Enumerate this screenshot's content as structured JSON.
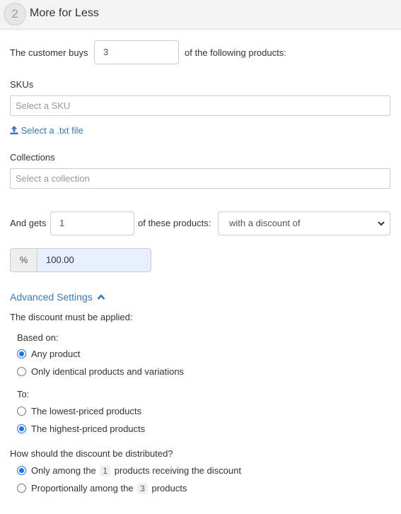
{
  "header": {
    "step": "2",
    "title": "More for Less"
  },
  "buy": {
    "prefix": "The customer buys",
    "quantity": "3",
    "suffix": "of the following products:"
  },
  "skus": {
    "label": "SKUs",
    "placeholder": "Select a SKU",
    "upload_link": "Select a .txt file"
  },
  "collections": {
    "label": "Collections",
    "placeholder": "Select a collection"
  },
  "gets": {
    "prefix": "And gets",
    "quantity": "1",
    "suffix": "of these products:",
    "discount_type": "with a discount of"
  },
  "discount": {
    "unit": "%",
    "value": "100.00"
  },
  "advanced": {
    "title": "Advanced Settings",
    "applied_label": "The discount must be applied:",
    "based_on": {
      "label": "Based on:",
      "options": [
        {
          "label": "Any product",
          "selected": true
        },
        {
          "label": "Only identical products and variations",
          "selected": false
        }
      ]
    },
    "to": {
      "label": "To:",
      "options": [
        {
          "label": "The lowest-priced products",
          "selected": false
        },
        {
          "label": "The highest-priced products",
          "selected": true
        }
      ]
    },
    "distribution": {
      "label": "How should the discount be distributed?",
      "option1": {
        "before": "Only among the",
        "count": "1",
        "after": "products receiving the discount",
        "selected": true
      },
      "option2": {
        "before": "Proportionally among the",
        "count": "3",
        "after": "products",
        "selected": false
      }
    }
  },
  "colors": {
    "accent": "#3a78b5",
    "radio": "#1a73e8",
    "autofill": "#e8f0fe"
  }
}
